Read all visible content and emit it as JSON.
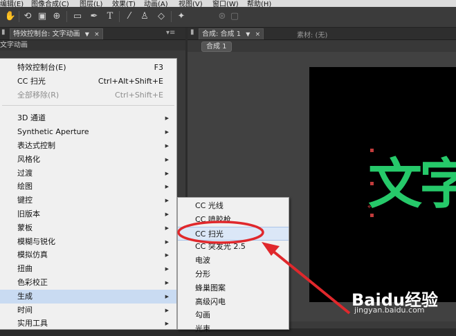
{
  "menubar": {
    "items": [
      "编辑(E)",
      "图像合成(C)",
      "图层(L)",
      "效果(T)",
      "动画(A)",
      "视图(V)",
      "窗口(W)",
      "帮助(H)"
    ]
  },
  "toolbar": {
    "tools": [
      "hand-tool-icon",
      "rotate-tool-icon",
      "camera-tool-icon",
      "pan-behind-tool-icon",
      "rectangle-tool-icon",
      "pen-tool-icon",
      "type-tool-icon",
      "brush-tool-icon",
      "clone-stamp-tool-icon",
      "eraser-tool-icon",
      "puppet-pin-tool-icon"
    ]
  },
  "left_panel": {
    "tab_label": "特效控制台: 文字动画",
    "subheader": "文字动画"
  },
  "right_panel": {
    "comp_tab": "合成: 合成 1",
    "footage_tab": "素材: (无)",
    "comp_subtab": "合成 1",
    "viewer_text": "文字"
  },
  "context_menu": {
    "items": [
      {
        "label": "特效控制台(E)",
        "shortcut": "F3",
        "submenu": false,
        "disabled": false
      },
      {
        "label": "CC 扫光",
        "shortcut": "Ctrl+Alt+Shift+E",
        "submenu": false,
        "disabled": false
      },
      {
        "label": "全部移除(R)",
        "shortcut": "Ctrl+Shift+E",
        "submenu": false,
        "disabled": true
      },
      {
        "label": "3D 通道",
        "shortcut": "",
        "submenu": true,
        "disabled": false
      },
      {
        "label": "Synthetic Aperture",
        "shortcut": "",
        "submenu": true,
        "disabled": false
      },
      {
        "label": "表达式控制",
        "shortcut": "",
        "submenu": true,
        "disabled": false
      },
      {
        "label": "风格化",
        "shortcut": "",
        "submenu": true,
        "disabled": false
      },
      {
        "label": "过渡",
        "shortcut": "",
        "submenu": true,
        "disabled": false
      },
      {
        "label": "绘图",
        "shortcut": "",
        "submenu": true,
        "disabled": false
      },
      {
        "label": "键控",
        "shortcut": "",
        "submenu": true,
        "disabled": false
      },
      {
        "label": "旧版本",
        "shortcut": "",
        "submenu": true,
        "disabled": false
      },
      {
        "label": "蒙板",
        "shortcut": "",
        "submenu": true,
        "disabled": false
      },
      {
        "label": "模糊与锐化",
        "shortcut": "",
        "submenu": true,
        "disabled": false
      },
      {
        "label": "模拟仿真",
        "shortcut": "",
        "submenu": true,
        "disabled": false
      },
      {
        "label": "扭曲",
        "shortcut": "",
        "submenu": true,
        "disabled": false
      },
      {
        "label": "色彩校正",
        "shortcut": "",
        "submenu": true,
        "disabled": false
      },
      {
        "label": "生成",
        "shortcut": "",
        "submenu": true,
        "disabled": false,
        "highlighted": true
      },
      {
        "label": "时间",
        "shortcut": "",
        "submenu": true,
        "disabled": false
      },
      {
        "label": "实用工具",
        "shortcut": "",
        "submenu": true,
        "disabled": false
      }
    ]
  },
  "submenu": {
    "items": [
      {
        "label": "CC 光线"
      },
      {
        "label": "CC 喷胶枪"
      },
      {
        "label": "CC 扫光",
        "highlighted": true
      },
      {
        "label": "CC 突发光 2.5"
      },
      {
        "label": "电波"
      },
      {
        "label": "分形"
      },
      {
        "label": "蜂巢图案"
      },
      {
        "label": "高级闪电"
      },
      {
        "label": "勾画"
      },
      {
        "label": "光束"
      }
    ]
  },
  "watermark": {
    "logo": "Baidu经验",
    "url": "jingyan.baidu.com"
  },
  "colors": {
    "viewer_text": "#26c96a",
    "annotation_red": "#e0282c",
    "menu_highlight": "#c9dbf2"
  }
}
